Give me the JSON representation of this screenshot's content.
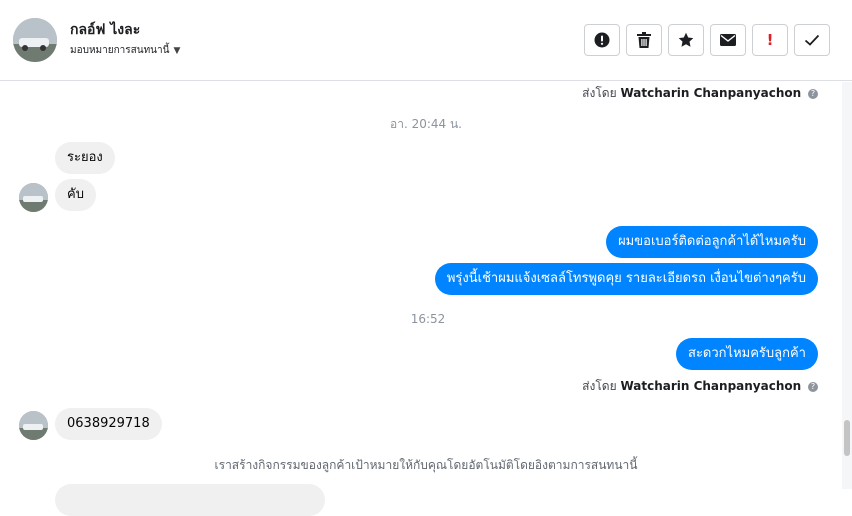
{
  "header": {
    "contact_name": "กลอ์ฟ ไงละ",
    "assign_label": "มอบหมายการสนทนานี้",
    "caret_icon": "caret-down-icon",
    "toolbar": [
      {
        "name": "spam-button",
        "icon": "alert-circle-icon"
      },
      {
        "name": "delete-button",
        "icon": "trash-icon"
      },
      {
        "name": "star-button",
        "icon": "star-icon"
      },
      {
        "name": "mark-unread-button",
        "icon": "envelope-icon"
      },
      {
        "name": "important-button",
        "icon": "exclamation-icon",
        "label": "!"
      },
      {
        "name": "done-button",
        "icon": "check-icon"
      }
    ]
  },
  "thread": {
    "sent_by_prefix": "ส่งโดย",
    "sent_by_name": "Watcharin Chanpanyachon",
    "sent_by_prefix_2": "ส่งโดย",
    "sent_by_name_2": "Watcharin Chanpanyachon",
    "timestamp_1": "อา. 20:44 น.",
    "in_msg_1": "ระยอง",
    "in_msg_2": "คับ",
    "out_msg_1": "ผมขอเบอร์ติดต่อลูกค้าได้ไหมครับ",
    "out_msg_2": "พรุ่งนี้เช้าผมแจ้งเซลล์โทรพูดคุย รายละเอียดรถ เงื่อนไขต่างๆครับ",
    "timestamp_2": "16:52",
    "out_msg_3": "สะดวกไหมครับลูกค้า",
    "in_msg_3": "0638929718",
    "notice": "เราสร้างกิจกรรมของลูกค้าเป้าหมายให้กับคุณโดยอัตโนมัติโดยอิงตามการสนทนานี้"
  },
  "colors": {
    "outgoing_bubble": "#0084ff",
    "incoming_bubble": "#f0f0f0",
    "important_icon": "#e02020"
  }
}
